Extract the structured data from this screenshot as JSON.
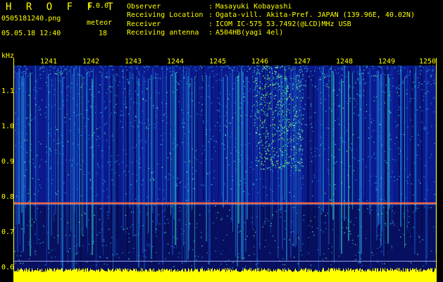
{
  "header": {
    "title": "H R O F F T",
    "version": "1.0.0",
    "file_name": "0505181240.png",
    "meteor_label": "meteor",
    "date_time": "05.05.18 12:40",
    "meteor_count": "18"
  },
  "info": [
    {
      "key": "Observer",
      "sep": ":",
      "value": "Masayuki Kobayashi"
    },
    {
      "key": "Receiving Location",
      "sep": ":",
      "value": "Ogata-vill. Akita-Pref. JAPAN (139.96E, 40.02N)"
    },
    {
      "key": "Receiver",
      "sep": ":",
      "value": "ICOM IC-575 53.7492(@LCD)MHz USB"
    },
    {
      "key": "Receiving antenna",
      "sep": ":",
      "value": "A504HB(yagi 4el)"
    }
  ],
  "axis": {
    "y_unit": "kHz",
    "y_labels": [
      "1.1",
      "1.0",
      "0.9",
      "0.8",
      "0.7",
      "0.6"
    ],
    "y_values": [
      1.1,
      1.0,
      0.9,
      0.8,
      0.7,
      0.6
    ],
    "x_labels": [
      "1241",
      "1242",
      "1243",
      "1244",
      "1245",
      "1246",
      "1247",
      "1248",
      "1249",
      "1250"
    ]
  },
  "colors": {
    "text": "#ffff00",
    "background": "#000000",
    "spectrogram_base": "#0a1a8c",
    "carrier_line": "#ff6040",
    "noise_bar": "#ffff00"
  }
}
